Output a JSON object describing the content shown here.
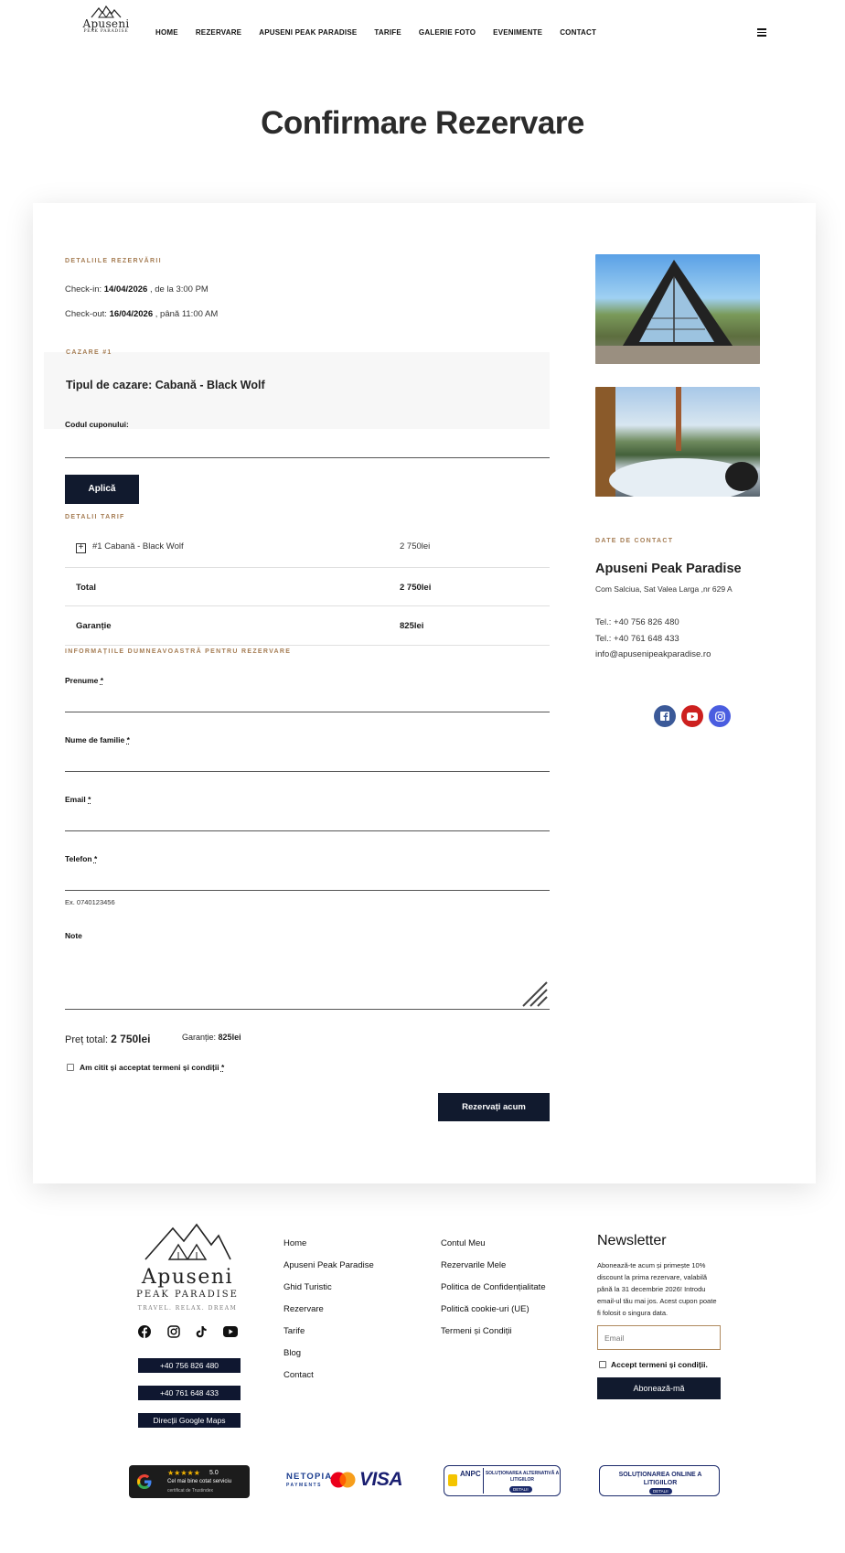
{
  "header": {
    "logo_title": "Apuseni",
    "logo_subtitle": "PEAK PARADISE",
    "nav": [
      "HOME",
      "REZERVARE",
      "APUSENI PEAK PARADISE",
      "TARIFE",
      "GALERIE FOTO",
      "EVENIMENTE",
      "CONTACT"
    ]
  },
  "page_title": "Confirmare Rezervare",
  "details": {
    "section_label": "DETALIILE REZERVĂRII",
    "checkin_prefix": "Check-in:",
    "checkin_date": "14/04/2026",
    "checkin_suffix": ", de la 3:00 PM",
    "checkout_prefix": "Check-out:",
    "checkout_date": "16/04/2026",
    "checkout_suffix": ", până 11:00 AM"
  },
  "accommodation": {
    "label": "CAZARE #1",
    "type": "Tipul de cazare: Cabană - Black Wolf",
    "coupon_label": "Codul cuponului:",
    "apply_button": "Aplică"
  },
  "pricing": {
    "label": "DETALII TARIF",
    "rows": [
      {
        "name": "#1 Cabană - Black Wolf",
        "value": "2 750lei"
      },
      {
        "name": "Total",
        "value": "2 750lei"
      },
      {
        "name": "Garanție",
        "value": "825lei"
      }
    ]
  },
  "form": {
    "label": "INFORMAȚIILE DUMNEAVOASTRĂ PENTRU REZERVARE",
    "first_name": "Prenume",
    "last_name": "Nume de familie",
    "email": "Email",
    "phone": "Telefon",
    "required_mark": "*",
    "phone_hint": "Ex. 0740123456",
    "notes": "Note",
    "total_label": "Preț total:",
    "total_value": "2 750lei",
    "deposit_label": "Garanție:",
    "deposit_value": "825lei",
    "terms": "Am citit și acceptat termeni și condiții",
    "submit": "Rezervați acum"
  },
  "contact": {
    "label": "DATE DE CONTACT",
    "name": "Apuseni Peak Paradise",
    "address": "Com Salciua, Sat Valea Larga ,nr 629 A",
    "phone1": "Tel.: +40 756 826 480",
    "phone2": "Tel.: +40 761 648 433",
    "email": "info@apusenipeakparadise.ro",
    "socials": [
      "facebook-icon",
      "youtube-icon",
      "instagram-icon"
    ],
    "social_colors": [
      "#3b5998",
      "#cd201f",
      "#4a5de0"
    ]
  },
  "footer": {
    "logo_title": "Apuseni",
    "logo_subtitle": "PEAK PARADISE",
    "logo_tagline": "TRAVEL. RELAX. DREAM",
    "phone_btn1": "+40 756 826 480",
    "phone_btn2": "+40 761 648 433",
    "maps_btn": "Direcții Google Maps",
    "col1": [
      "Home",
      "Apuseni Peak Paradise",
      "Ghid Turistic",
      "Rezervare",
      "Tarife",
      "Blog",
      "Contact"
    ],
    "col2": [
      "Contul Meu",
      "Rezervarile Mele",
      "Politica de Confidențialitate",
      "Politică cookie-uri (UE)",
      "Termeni și Condiții"
    ],
    "newsletter_title": "Newsletter",
    "newsletter_text": "Abonează-te acum și primește 10% discount la prima rezervare, valabilă până la 31 decembrie 2026! Introdu email-ul tău mai jos. Acest cupon poate fi folosit o singura data.",
    "newsletter_placeholder": "Email",
    "newsletter_terms": "Accept termeni și condiții.",
    "newsletter_button": "Abonează-mă",
    "google_rating": "5.0",
    "google_line1": "Cel mai bine cotat serviciu",
    "google_line2": "certificat de Trustindex",
    "netopia": "NETOPIA",
    "netopia_sub": "PAYMENTS",
    "visa": "VISA",
    "anpc_title": "ANPC",
    "anpc_text": "SOLUȚIONAREA ALTERNATIVĂ A LITIGIILOR",
    "anpc_details": "DETALII",
    "sol_text": "SOLUȚIONAREA ONLINE A LITIGIILOR",
    "sol_details": "DETALII"
  }
}
